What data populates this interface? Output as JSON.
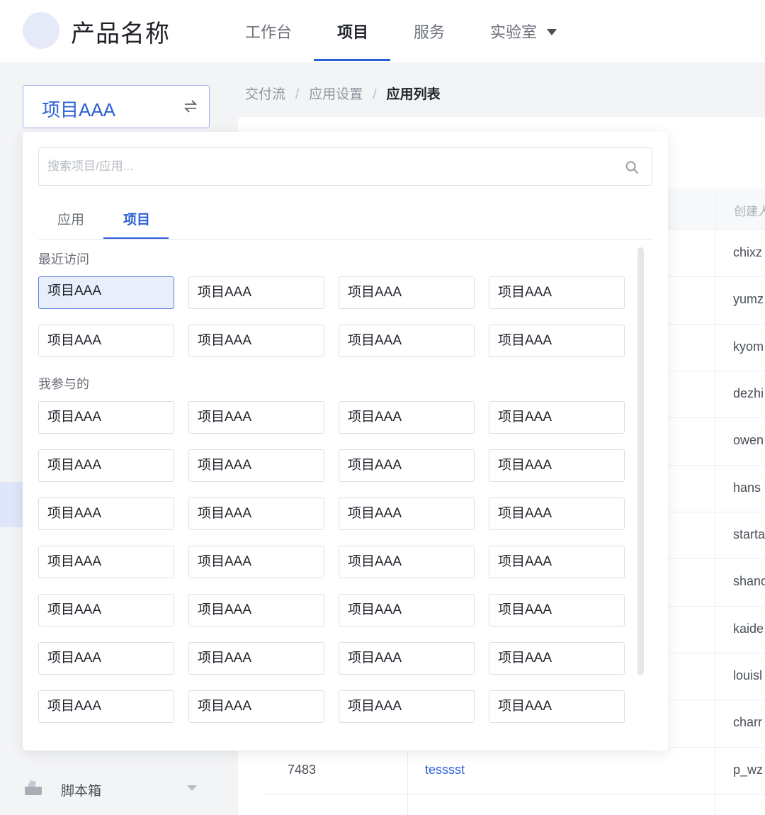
{
  "header": {
    "product_name": "产品名称",
    "nav": [
      "工作台",
      "项目",
      "服务",
      "实验室"
    ],
    "active_nav": "项目"
  },
  "sidebar": {
    "current_project": "项目AAA",
    "bottom_item": "脚本箱"
  },
  "breadcrumb": [
    "交付流",
    "应用设置",
    "应用列表"
  ],
  "table": {
    "creator_header": "创建人",
    "creators": [
      "chixz",
      "yumz",
      "kyom",
      "dezhi",
      "owen",
      "hans",
      "starta",
      "shanc",
      "kaide",
      "louisl",
      "charr",
      "p_wz"
    ],
    "visible_row": {
      "id": "7483",
      "name": "tesssst"
    }
  },
  "panel": {
    "search_placeholder": "搜索项目/应用...",
    "tabs": [
      "应用",
      "项目"
    ],
    "active_tab": "项目",
    "recent_title": "最近访问",
    "recent_items": [
      "项目AAA",
      "项目AAA",
      "项目AAA",
      "项目AAA",
      "项目AAA",
      "项目AAA",
      "项目AAA",
      "项目AAA"
    ],
    "joined_title": "我参与的",
    "joined_items": [
      "项目AAA",
      "项目AAA",
      "项目AAA",
      "项目AAA",
      "项目AAA",
      "项目AAA",
      "项目AAA",
      "项目AAA",
      "项目AAA",
      "项目AAA",
      "项目AAA",
      "项目AAA",
      "项目AAA",
      "项目AAA",
      "项目AAA",
      "项目AAA",
      "项目AAA",
      "项目AAA",
      "项目AAA",
      "项目AAA",
      "项目AAA",
      "项目AAA",
      "项目AAA",
      "项目AAA",
      "项目AAA",
      "项目AAA",
      "项目AAA",
      "项目AAA"
    ]
  },
  "colors": {
    "accent": "#2c5fd6",
    "selected_bg": "#e8eefc"
  }
}
